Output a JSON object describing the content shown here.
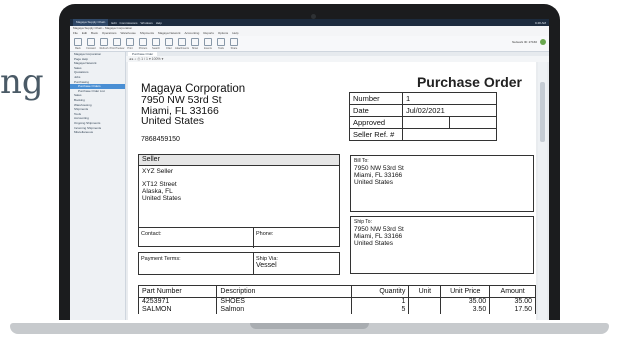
{
  "background": {
    "text": "ng"
  },
  "os_taskbar": {
    "app": "Magaya Supply Chain",
    "items": [
      "Edit",
      "Commissions",
      "Windows",
      "Help"
    ],
    "tray": "9:48 AM"
  },
  "window": {
    "title": "Magaya Supply Chain - Magaya Corporation"
  },
  "menu": {
    "items": [
      "File",
      "Edit",
      "Book",
      "Operations",
      "Warehouse",
      "Shipments",
      "Magaya Network",
      "Accounting",
      "Reports",
      "Options",
      "Help"
    ]
  },
  "ribbon": {
    "buttons": [
      "Back",
      "Forward",
      "Refresh",
      "Print Preview",
      "Print",
      "Printers",
      "Search",
      "Filter",
      "Attachments",
      "Show",
      "Events",
      "Tools",
      "Share"
    ],
    "user": "Network ID: 27160"
  },
  "sidebar": {
    "items": [
      {
        "label": "Magaya Corporation",
        "sub": false,
        "selected": false
      },
      {
        "label": "Page Help",
        "sub": false,
        "selected": false
      },
      {
        "label": "Magaya Network",
        "sub": false,
        "selected": false
      },
      {
        "label": "Sales",
        "sub": false,
        "selected": false
      },
      {
        "label": "Quotations",
        "sub": false,
        "selected": false
      },
      {
        "label": "Jobs",
        "sub": false,
        "selected": false
      },
      {
        "label": "Purchasing",
        "sub": false,
        "selected": false
      },
      {
        "label": "Purchase Orders",
        "sub": true,
        "selected": true
      },
      {
        "label": "Purchase Order List",
        "sub": true,
        "selected": false
      },
      {
        "label": "Sales",
        "sub": false,
        "selected": false
      },
      {
        "label": "Booking",
        "sub": false,
        "selected": false
      },
      {
        "label": "Warehousing",
        "sub": false,
        "selected": false
      },
      {
        "label": "Shipments",
        "sub": false,
        "selected": false
      },
      {
        "label": "Tools",
        "sub": false,
        "selected": false
      },
      {
        "label": "Accounting",
        "sub": false,
        "selected": false
      },
      {
        "label": "Ongoing Shipments",
        "sub": false,
        "selected": false
      },
      {
        "label": "Incoming Shipments",
        "sub": false,
        "selected": false
      },
      {
        "label": "Miscellaneous",
        "sub": false,
        "selected": false
      }
    ]
  },
  "tabs": [
    {
      "label": "Purchase Order"
    }
  ],
  "doc_toolbar": {
    "text": "◂ ▸ ⌕ ⎙ 1 / 1 ▾ 100% ▾"
  },
  "po": {
    "title": "Purchase Order",
    "company": {
      "name": "Magaya Corporation",
      "line1": "7950 NW 53rd St",
      "line2": "Miami, FL 33166",
      "line3": "United States",
      "phone": "7868459150"
    },
    "info": {
      "number_label": "Number",
      "number": "1",
      "date_label": "Date",
      "date": "Jul/02/2021",
      "approved_label": "Approved",
      "seller_ref_label": "Seller Ref. #"
    },
    "seller": {
      "header": "Seller",
      "name": "XYZ Seller",
      "line1": "XT12 Street",
      "line2": "Alaska, FL",
      "line3": "United States",
      "contact_label": "Contact:",
      "phone_label": "Phone:"
    },
    "payment": {
      "terms_label": "Payment Terms:",
      "shipvia_label": "Ship Via:",
      "shipvia": "Vessel"
    },
    "bill_to": {
      "label": "Bill To:",
      "line1": "7950 NW 53rd St",
      "line2": "Miami, FL 33166",
      "line3": "United States"
    },
    "ship_to": {
      "label": "Ship To:",
      "line1": "7950 NW 53rd St",
      "line2": "Miami, FL 33166",
      "line3": "United States"
    },
    "columns": {
      "part": "Part Number",
      "desc": "Description",
      "qty": "Quantity",
      "unit": "Unit",
      "price": "Unit Price",
      "amount": "Amount"
    },
    "rows": [
      {
        "part": "4253971",
        "desc": "SHOES",
        "qty": "1",
        "unit": "",
        "price": "35.00",
        "amount": "35.00"
      },
      {
        "part": "SALMON",
        "desc": "Salmon",
        "qty": "5",
        "unit": "",
        "price": "3.50",
        "amount": "17.50"
      }
    ]
  }
}
